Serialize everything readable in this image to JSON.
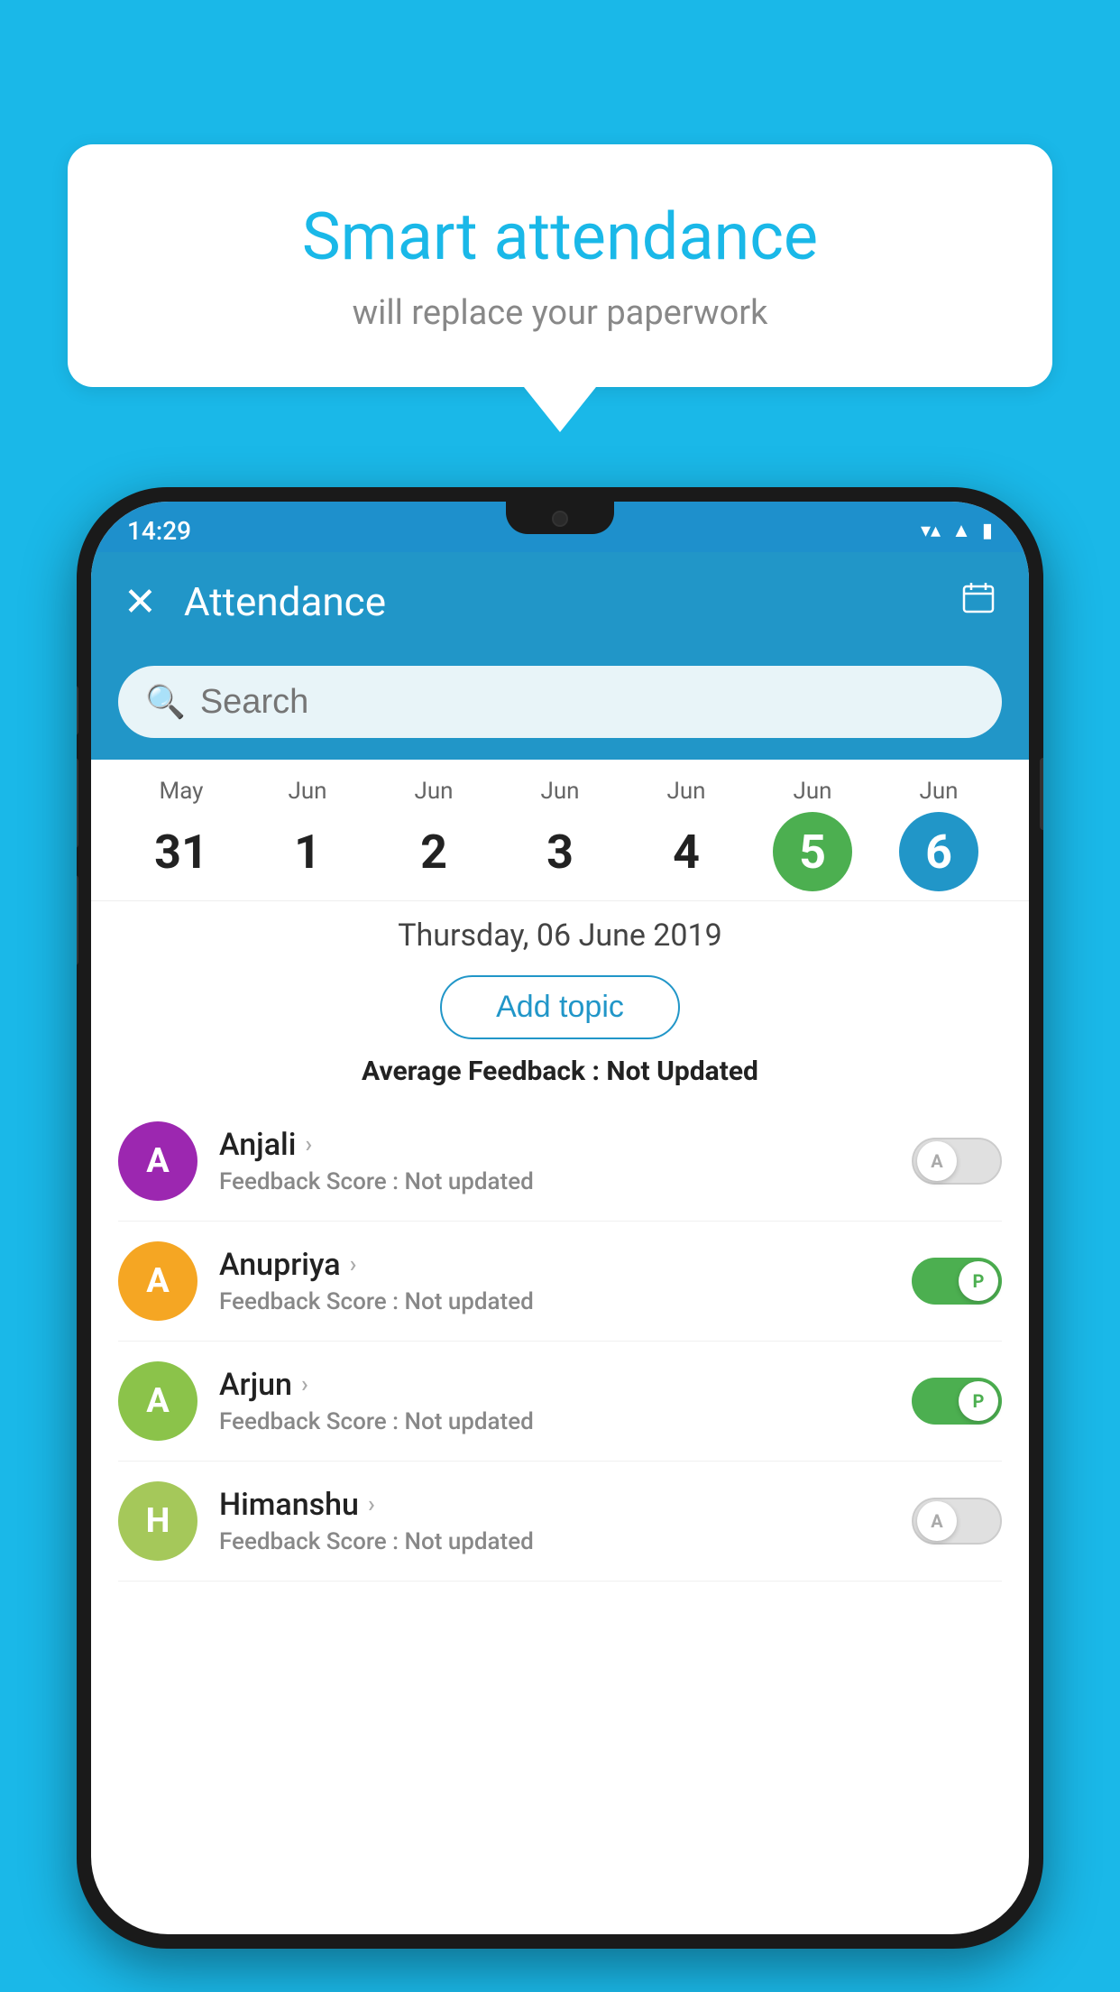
{
  "background_color": "#1ab8e8",
  "speech_bubble": {
    "title": "Smart attendance",
    "subtitle": "will replace your paperwork"
  },
  "status_bar": {
    "time": "14:29",
    "icons": [
      "wifi",
      "signal",
      "battery"
    ]
  },
  "app_bar": {
    "title": "Attendance",
    "close_label": "×",
    "calendar_icon": "📅"
  },
  "search": {
    "placeholder": "Search"
  },
  "calendar": {
    "days": [
      {
        "month": "May",
        "date": "31",
        "style": "normal"
      },
      {
        "month": "Jun",
        "date": "1",
        "style": "normal"
      },
      {
        "month": "Jun",
        "date": "2",
        "style": "normal"
      },
      {
        "month": "Jun",
        "date": "3",
        "style": "normal"
      },
      {
        "month": "Jun",
        "date": "4",
        "style": "normal"
      },
      {
        "month": "Jun",
        "date": "5",
        "style": "green"
      },
      {
        "month": "Jun",
        "date": "6",
        "style": "blue"
      }
    ]
  },
  "selected_date": "Thursday, 06 June 2019",
  "add_topic_label": "Add topic",
  "average_feedback_label": "Average Feedback :",
  "average_feedback_value": "Not Updated",
  "students": [
    {
      "name": "Anjali",
      "avatar_letter": "A",
      "avatar_color": "#9c27b0",
      "feedback_label": "Feedback Score :",
      "feedback_value": "Not updated",
      "toggle": "off",
      "toggle_letter": "A"
    },
    {
      "name": "Anupriya",
      "avatar_letter": "A",
      "avatar_color": "#f5a623",
      "feedback_label": "Feedback Score :",
      "feedback_value": "Not updated",
      "toggle": "on",
      "toggle_letter": "P"
    },
    {
      "name": "Arjun",
      "avatar_letter": "A",
      "avatar_color": "#8bc34a",
      "feedback_label": "Feedback Score :",
      "feedback_value": "Not updated",
      "toggle": "on",
      "toggle_letter": "P"
    },
    {
      "name": "Himanshu",
      "avatar_letter": "H",
      "avatar_color": "#a5c85a",
      "feedback_label": "Feedback Score :",
      "feedback_value": "Not updated",
      "toggle": "off",
      "toggle_letter": "A"
    }
  ]
}
